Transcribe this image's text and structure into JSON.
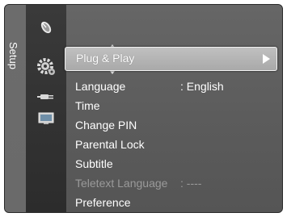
{
  "sidebar": {
    "title": "Setup"
  },
  "categories": [
    {
      "name": "picture-category",
      "icon": "satellite-dish-icon"
    },
    {
      "name": "setup-category",
      "icon": "gear-icon",
      "selected": true
    },
    {
      "name": "input-category",
      "icon": "plug-icon"
    },
    {
      "name": "application-category",
      "icon": "screen-icon"
    }
  ],
  "menu": {
    "selected_item": {
      "label": "Plug & Play"
    },
    "items": [
      {
        "label": "Language",
        "value": ": English",
        "enabled": true
      },
      {
        "label": "Time",
        "value": "",
        "enabled": true
      },
      {
        "label": "Change PIN",
        "value": "",
        "enabled": true
      },
      {
        "label": "Parental Lock",
        "value": "",
        "enabled": true
      },
      {
        "label": "Subtitle",
        "value": "",
        "enabled": true
      },
      {
        "label": "Teletext Language",
        "value": ": ----",
        "enabled": false
      },
      {
        "label": "Preference",
        "value": "",
        "enabled": true
      }
    ]
  },
  "colors": {
    "menu_background": "#5b5b5b",
    "highlight": "#b5b5b5",
    "disabled_text": "#9a9a9a"
  }
}
